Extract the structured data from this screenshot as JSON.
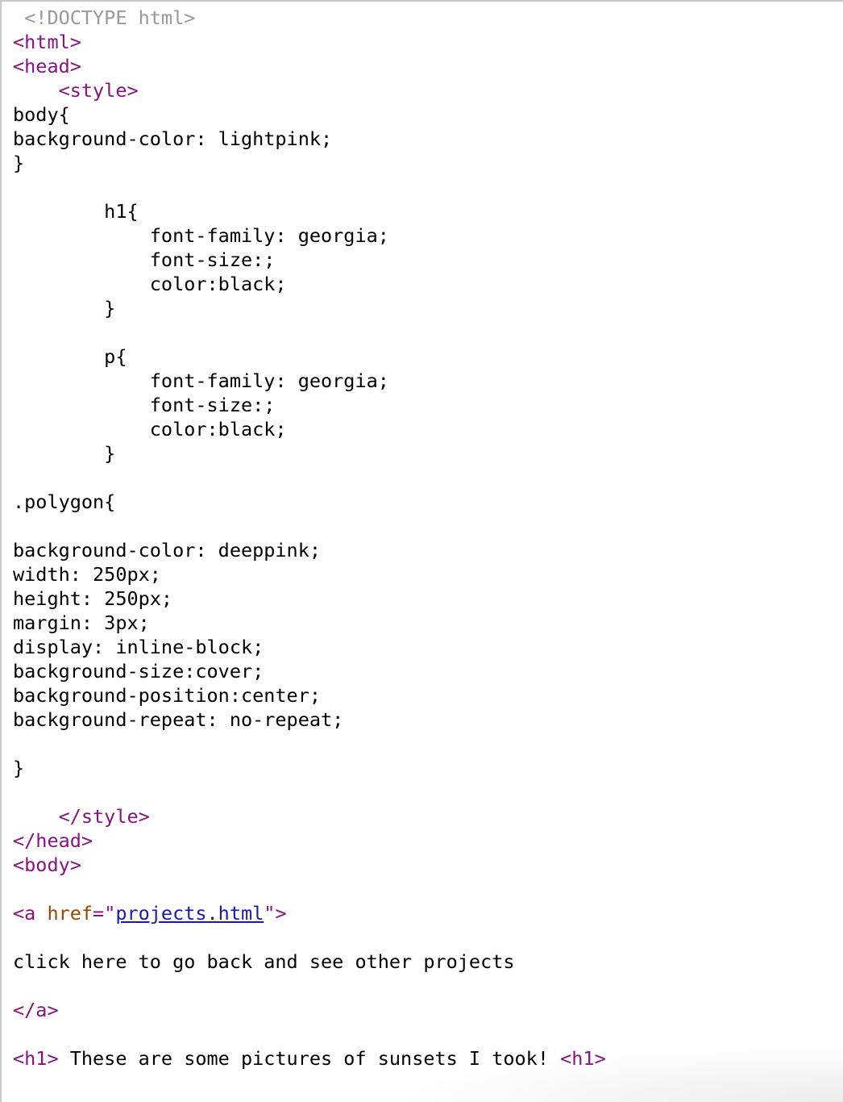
{
  "view": "source code listing",
  "colors": {
    "tag": "#881280",
    "doctype": "#999999",
    "attribute": "#994500",
    "text": "#000000",
    "link": "#1a1aa6",
    "frame_border": "#c8c8c8"
  },
  "lines": [
    {
      "segments": [
        {
          "t": "doctype",
          "s": " <!DOCTYPE html>"
        }
      ]
    },
    {
      "segments": [
        {
          "t": "tag",
          "s": "<html>"
        }
      ]
    },
    {
      "segments": [
        {
          "t": "tag",
          "s": "<head>"
        }
      ]
    },
    {
      "segments": [
        {
          "t": "text",
          "s": "    "
        },
        {
          "t": "tag",
          "s": "<style>"
        }
      ]
    },
    {
      "segments": [
        {
          "t": "text",
          "s": "body{"
        }
      ]
    },
    {
      "segments": [
        {
          "t": "text",
          "s": "background-color: lightpink;"
        }
      ]
    },
    {
      "segments": [
        {
          "t": "text",
          "s": "}"
        }
      ]
    },
    {
      "segments": [
        {
          "t": "text",
          "s": "        h1{"
        }
      ]
    },
    {
      "segments": [
        {
          "t": "text",
          "s": "            font-family: georgia;"
        }
      ]
    },
    {
      "segments": [
        {
          "t": "text",
          "s": "            font-size:;"
        }
      ]
    },
    {
      "segments": [
        {
          "t": "text",
          "s": "            color:black;"
        }
      ]
    },
    {
      "segments": [
        {
          "t": "text",
          "s": "        }"
        }
      ]
    },
    {
      "segments": [
        {
          "t": "text",
          "s": "        p{"
        }
      ]
    },
    {
      "segments": [
        {
          "t": "text",
          "s": "            font-family: georgia;"
        }
      ]
    },
    {
      "segments": [
        {
          "t": "text",
          "s": "            font-size:;"
        }
      ]
    },
    {
      "segments": [
        {
          "t": "text",
          "s": "            color:black;"
        }
      ]
    },
    {
      "segments": [
        {
          "t": "text",
          "s": "        }"
        }
      ]
    },
    {
      "segments": [
        {
          "t": "text",
          "s": ".polygon{"
        }
      ]
    },
    {
      "segments": [
        {
          "t": "text",
          "s": "background-color: deeppink;"
        }
      ]
    },
    {
      "segments": [
        {
          "t": "text",
          "s": "width: 250px;"
        }
      ]
    },
    {
      "segments": [
        {
          "t": "text",
          "s": "height: 250px;"
        }
      ]
    },
    {
      "segments": [
        {
          "t": "text",
          "s": "margin: 3px;"
        }
      ]
    },
    {
      "segments": [
        {
          "t": "text",
          "s": "display: inline-block;"
        }
      ]
    },
    {
      "segments": [
        {
          "t": "text",
          "s": "background-size:cover;"
        }
      ]
    },
    {
      "segments": [
        {
          "t": "text",
          "s": "background-position:center;"
        }
      ]
    },
    {
      "segments": [
        {
          "t": "text",
          "s": "background-repeat: no-repeat;"
        }
      ]
    },
    {
      "segments": [
        {
          "t": "text",
          "s": "}"
        }
      ]
    },
    {
      "segments": [
        {
          "t": "text",
          "s": "    "
        },
        {
          "t": "tag",
          "s": "</style>"
        }
      ]
    },
    {
      "segments": [
        {
          "t": "tag",
          "s": "</head>"
        }
      ]
    },
    {
      "segments": [
        {
          "t": "tag",
          "s": "<body>"
        }
      ]
    },
    {
      "segments": [
        {
          "t": "tag",
          "s": "<a "
        },
        {
          "t": "attr",
          "s": "href"
        },
        {
          "t": "tag",
          "s": "=\""
        },
        {
          "t": "link",
          "s": "projects.html"
        },
        {
          "t": "tag",
          "s": "\">"
        }
      ]
    },
    {
      "segments": [
        {
          "t": "text",
          "s": "click here to go back and see other projects"
        }
      ]
    },
    {
      "segments": [
        {
          "t": "tag",
          "s": "</a>"
        }
      ]
    },
    {
      "segments": [
        {
          "t": "tag",
          "s": "<h1>"
        },
        {
          "t": "text",
          "s": " These are some pictures of sunsets I took! "
        },
        {
          "t": "tag",
          "s": "<h1>"
        }
      ]
    }
  ]
}
